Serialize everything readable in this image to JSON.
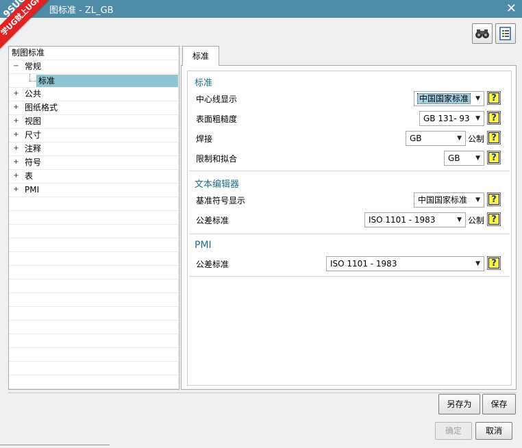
{
  "window": {
    "title": "图标准 - ZL_GB",
    "watermark_top": "9SUG",
    "watermark_ribbon": "学UG就上UG网",
    "close_glyph": "✕"
  },
  "toolbar": {
    "icons": [
      "binoculars-icon",
      "settings-list-icon"
    ]
  },
  "tree": {
    "root": "制图标准",
    "items": [
      {
        "label": "常规",
        "toggle": "−",
        "level": 1
      },
      {
        "label": "标准",
        "toggle": "",
        "level": 2,
        "selected": true
      },
      {
        "label": "公共",
        "toggle": "+",
        "level": 1
      },
      {
        "label": "图纸格式",
        "toggle": "+",
        "level": 1
      },
      {
        "label": "视图",
        "toggle": "+",
        "level": 1
      },
      {
        "label": "尺寸",
        "toggle": "+",
        "level": 1
      },
      {
        "label": "注释",
        "toggle": "+",
        "level": 1
      },
      {
        "label": "符号",
        "toggle": "+",
        "level": 1
      },
      {
        "label": "表",
        "toggle": "+",
        "level": 1
      },
      {
        "label": "PMI",
        "toggle": "+",
        "level": 1
      }
    ]
  },
  "tab": {
    "label": "标准"
  },
  "sections": {
    "standard": {
      "title": "标准",
      "centerline": {
        "label": "中心线显示",
        "value": "中国国家标准"
      },
      "roughness": {
        "label": "表面粗糙度",
        "value": "GB 131- 93"
      },
      "weld": {
        "label": "焊接",
        "value": "GB",
        "unit": "公制"
      },
      "limits": {
        "label": "限制和拟合",
        "value": "GB"
      }
    },
    "text_editor": {
      "title": "文本编辑器",
      "datum": {
        "label": "基准符号显示",
        "value": "中国国家标准"
      },
      "tolerance": {
        "label": "公差标准",
        "value": "ISO 1101 - 1983",
        "unit": "公制"
      }
    },
    "pmi": {
      "title": "PMI",
      "tolerance": {
        "label": "公差标准",
        "value": "ISO 1101 - 1983"
      }
    }
  },
  "help_glyph": "?",
  "arrow_glyph": "▼",
  "buttons": {
    "save_as": "另存为",
    "save": "保存",
    "ok": "确定",
    "cancel": "取消"
  }
}
